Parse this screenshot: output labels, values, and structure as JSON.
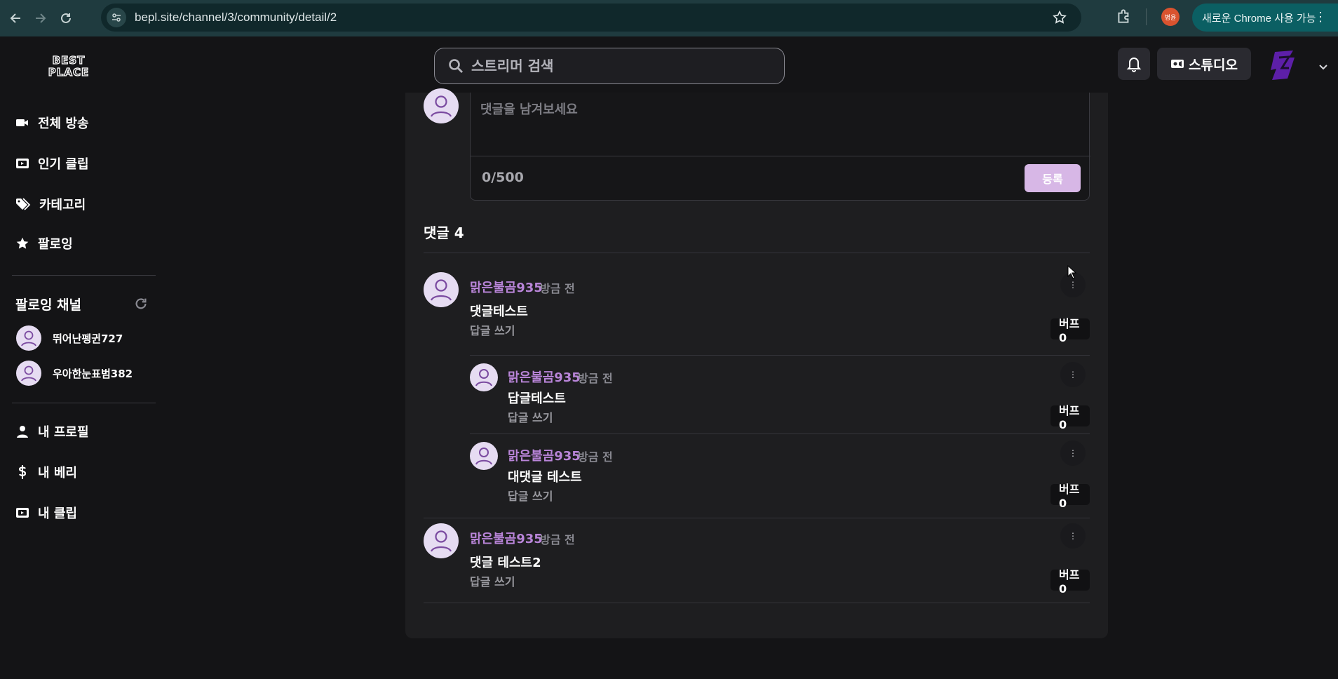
{
  "browser": {
    "url": "bepl.site/channel/3/community/detail/2",
    "profile_initials": "병윤",
    "update_label": "새로운 Chrome 사용 가능"
  },
  "header": {
    "logo_line1": "BEST",
    "logo_line2": "PLACE",
    "search_placeholder": "스트리머 검색",
    "studio_label": "스튜디오"
  },
  "sidebar": {
    "nav": [
      {
        "label": "전체 방송",
        "icon": "video-camera-icon"
      },
      {
        "label": "인기 클립",
        "icon": "clip-icon"
      },
      {
        "label": "카테고리",
        "icon": "tags-icon"
      },
      {
        "label": "팔로잉",
        "icon": "star-icon"
      }
    ],
    "following_title": "팔로잉 채널",
    "following": [
      {
        "name": "뛰어난펭귄727"
      },
      {
        "name": "우아한눈표범382"
      }
    ],
    "account": [
      {
        "label": "내 프로필",
        "icon": "user-icon"
      },
      {
        "label": "내 베리",
        "icon": "dollar-icon"
      },
      {
        "label": "내 클립",
        "icon": "clip-icon"
      }
    ]
  },
  "composer": {
    "placeholder": "댓글을 남겨보세요",
    "counter": "0/500",
    "submit_label": "등록"
  },
  "comments": {
    "title": "댓글 4",
    "items": [
      {
        "nick": "맑은불곰935",
        "time": "방금 전",
        "body": "댓글테스트",
        "reply": "답글 쓰기",
        "buff": "버프 0",
        "level": 0
      },
      {
        "nick": "맑은불곰935",
        "time": "방금 전",
        "body": "답글테스트",
        "reply": "답글 쓰기",
        "buff": "버프 0",
        "level": 1
      },
      {
        "nick": "맑은불곰935",
        "time": "방금 전",
        "body": "대댓글 테스트",
        "reply": "답글 쓰기",
        "buff": "버프 0",
        "level": 1
      },
      {
        "nick": "맑은불곰935",
        "time": "방금 전",
        "body": "댓글 테스트2",
        "reply": "답글 쓰기",
        "buff": "버프 0",
        "level": 0
      }
    ]
  },
  "colors": {
    "accent": "#b985d9",
    "submit_bg": "#d7b7e6",
    "background": "#141416",
    "panel": "#1e1e20"
  }
}
